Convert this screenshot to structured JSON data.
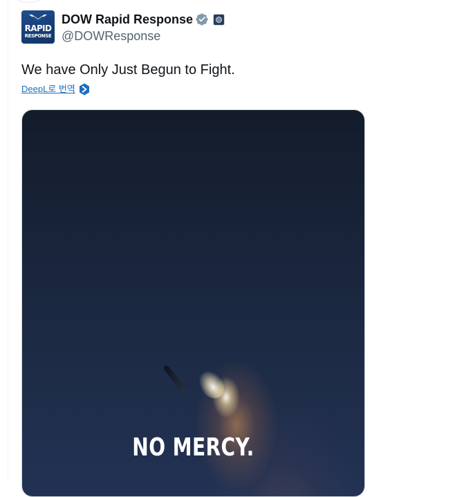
{
  "tweet": {
    "author": {
      "display_name": "DOW Rapid Response",
      "handle": "@DOWResponse",
      "avatar": {
        "line1": "RAPID",
        "line2": "RESPONSE",
        "background": "#1b4680"
      },
      "verified_icon": "verified-badge-icon",
      "verified_color": "#829aab",
      "affiliate_icon": "affiliate-badge-icon"
    },
    "text": "We have Only Just Begun to Fight.",
    "translate": {
      "label": "DeepL로 번역",
      "icon": "deepl-icon",
      "color": "#1d6fb8"
    },
    "media": {
      "caption": "NO MERCY."
    }
  }
}
